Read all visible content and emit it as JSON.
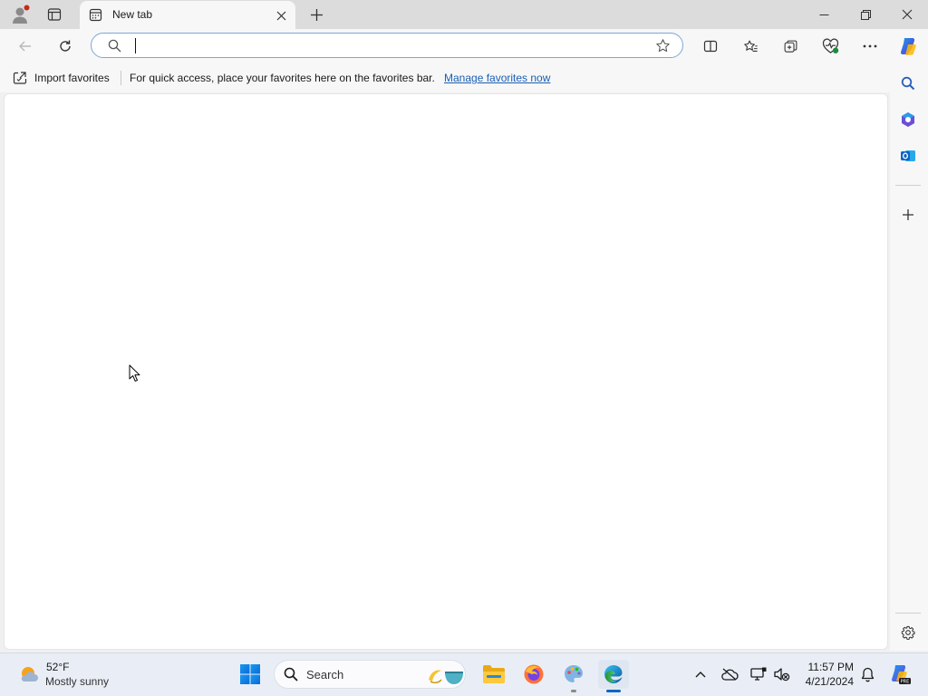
{
  "tab": {
    "title": "New tab"
  },
  "address_bar": {
    "value": "",
    "placeholder": ""
  },
  "favorites_bar": {
    "import_label": "Import favorites",
    "message": "For quick access, place your favorites here on the favorites bar.",
    "manage_link": "Manage favorites now"
  },
  "taskbar": {
    "weather": {
      "temperature": "52°F",
      "condition": "Mostly sunny"
    },
    "search_label": "Search",
    "clock": {
      "time": "11:57 PM",
      "date": "4/21/2024"
    }
  },
  "colors": {
    "accent": "#0067c0",
    "link": "#1a5fb4",
    "profile_badge": "#c42b1c",
    "favorite_health_badge": "#1e8a3e"
  }
}
